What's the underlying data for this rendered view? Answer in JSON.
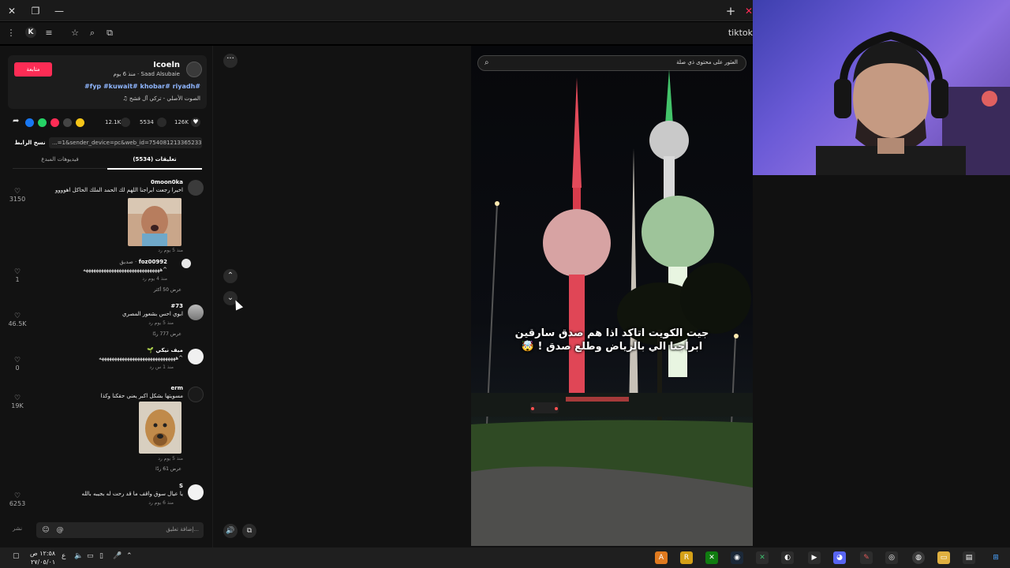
{
  "browser": {
    "url_partial": "tiktok",
    "title_buttons": {
      "close": "✕",
      "restore": "❐",
      "minimize": "—",
      "new_tab": "+"
    }
  },
  "author": {
    "follow_label": "متابعة",
    "name": "Icoeln",
    "sub": "Saad Alsubaie · منذ 6 يوم",
    "hashtags": "#fyp #kuwait# khobar# riyadh#",
    "sound": "الصوت الأصلي - تركي آل فشخ ♫"
  },
  "stats": {
    "likes": "126K",
    "comments": "5534",
    "saves": "12.1K"
  },
  "link": {
    "copy_label": "نسخ الرابط",
    "url": "...=1&sender_device=pc&web_id=7540812133652334085"
  },
  "tabs": {
    "comments": "تعليقات (5534)",
    "creator_videos": "فيديوهات المبدع"
  },
  "comments": [
    {
      "user": "0moon0ka",
      "text": "اخيرا رجعت ابراجنا اللهم لك الحمد الملك الحاكل اهوووو",
      "meta": "منذ 5 يوم   رد",
      "likes": "3150"
    },
    {
      "user": "foz00992",
      "user_tag": "· صديق",
      "text": "^ههههههههههههههههههههههههههههههه",
      "meta": "منذ 4 يوم   رد",
      "more": "عرض 50 أكثر",
      "likes": "1"
    },
    {
      "user": "#73",
      "text": "ابوي احس بشعور المصري",
      "meta": "منذ 5 يوم   رد",
      "more": "عرض 777 ردًا",
      "likes": "46.5K"
    },
    {
      "user": "ميف نيكي 🌱",
      "text": "^ههههههههههههههههههههههههههههههه",
      "meta": "منذ 1 س   رد",
      "likes": "0"
    },
    {
      "user": "erm",
      "text": "مسويتها بشكل اكبر يعني حقكنا وكذا",
      "meta": "منذ 5 يوم   رد",
      "more": "عرض 61 ردًا",
      "likes": "19K"
    },
    {
      "user": "S",
      "text": "يا عيال سوق واقف ما قد رحت له بجيبه بالله",
      "meta": "منذ 6 يوم   رد",
      "likes": "6253"
    }
  ],
  "input": {
    "post_label": "نشر",
    "placeholder": "...إضافة تعليق"
  },
  "video": {
    "search_placeholder": "العثور على محتوى ذي صلة",
    "caption_line1": "جيت الكويت اتاكد اذا هم صدق سارقين",
    "caption_line2": "ابراجنا الي بالرياض وطلع صدق ! 🤯"
  },
  "taskbar": {
    "time": "١٢:٥٨ ص",
    "date": "٢٧/٠٥/٠١",
    "lang": "ع"
  },
  "colors": {
    "accent": "#fe2c55",
    "hashtag": "#8fb6ff",
    "bg": "#121212"
  }
}
